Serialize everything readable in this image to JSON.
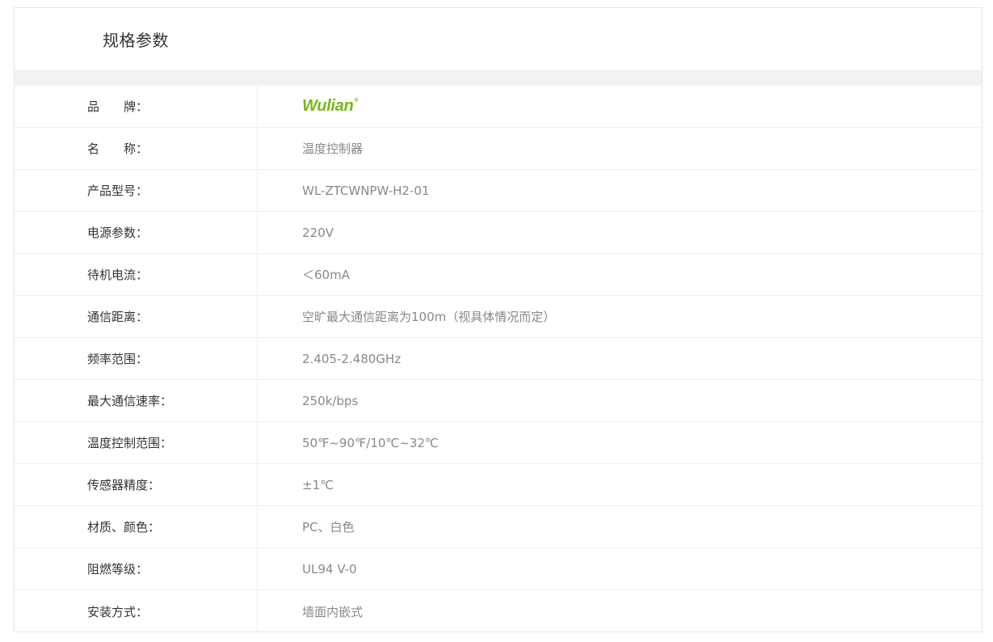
{
  "section": {
    "title": "规格参数"
  },
  "brand": {
    "logo_text": "Wulian",
    "logo_mark": "®",
    "color": "#7ab51d"
  },
  "specs": [
    {
      "label": "品　　牌：",
      "value": ""
    },
    {
      "label": "名　　称：",
      "value": "温度控制器"
    },
    {
      "label": "产品型号：",
      "value": "WL-ZTCWNPW-H2-01"
    },
    {
      "label": "电源参数：",
      "value": "220V"
    },
    {
      "label": "待机电流：",
      "value": "＜60mA"
    },
    {
      "label": "通信距离：",
      "value": "空旷最大通信距离为100m（视具体情况而定）"
    },
    {
      "label": "频率范围：",
      "value": "2.405-2.480GHz"
    },
    {
      "label": "最大通信速率：",
      "value": "250k/bps"
    },
    {
      "label": "温度控制范围：",
      "value": "50℉~90℉/10℃~32℃"
    },
    {
      "label": "传感器精度：",
      "value": "±1℃"
    },
    {
      "label": "材质、颜色：",
      "value": "PC、白色"
    },
    {
      "label": "阻燃等级：",
      "value": "UL94 V-0"
    },
    {
      "label": "安装方式：",
      "value": "墙面内嵌式"
    }
  ]
}
